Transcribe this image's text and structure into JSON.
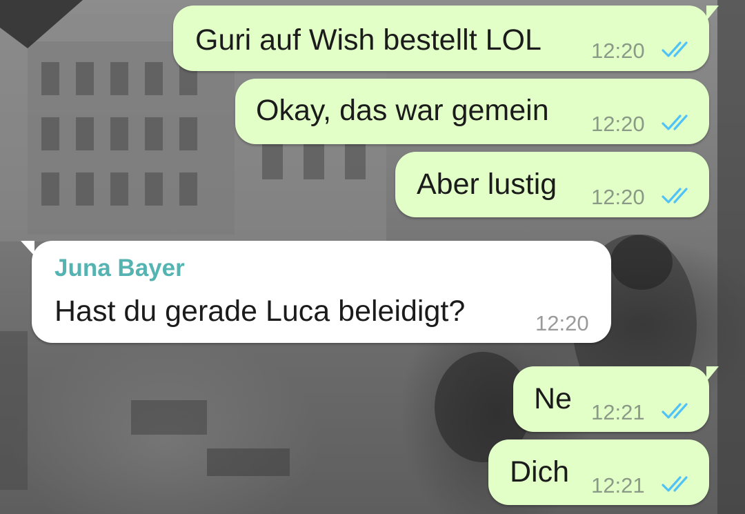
{
  "colors": {
    "outgoing_bubble": "#e1ffc7",
    "incoming_bubble": "#ffffff",
    "sender_name": "#55b3b1",
    "read_ticks": "#4fc3f7"
  },
  "messages": [
    {
      "direction": "outgoing",
      "text": "Guri auf Wish bestellt LOL",
      "time": "12:20",
      "status_icon": "double-check-read-icon"
    },
    {
      "direction": "outgoing",
      "text": "Okay, das war gemein",
      "time": "12:20",
      "status_icon": "double-check-read-icon"
    },
    {
      "direction": "outgoing",
      "text": "Aber lustig",
      "time": "12:20",
      "status_icon": "double-check-read-icon"
    },
    {
      "direction": "incoming",
      "sender": "Juna Bayer",
      "text": "Hast du gerade Luca beleidigt?",
      "time": "12:20"
    },
    {
      "direction": "outgoing",
      "text": "Ne",
      "time": "12:21",
      "status_icon": "double-check-read-icon"
    },
    {
      "direction": "outgoing",
      "text": "Dich",
      "time": "12:21",
      "status_icon": "double-check-read-icon"
    }
  ]
}
